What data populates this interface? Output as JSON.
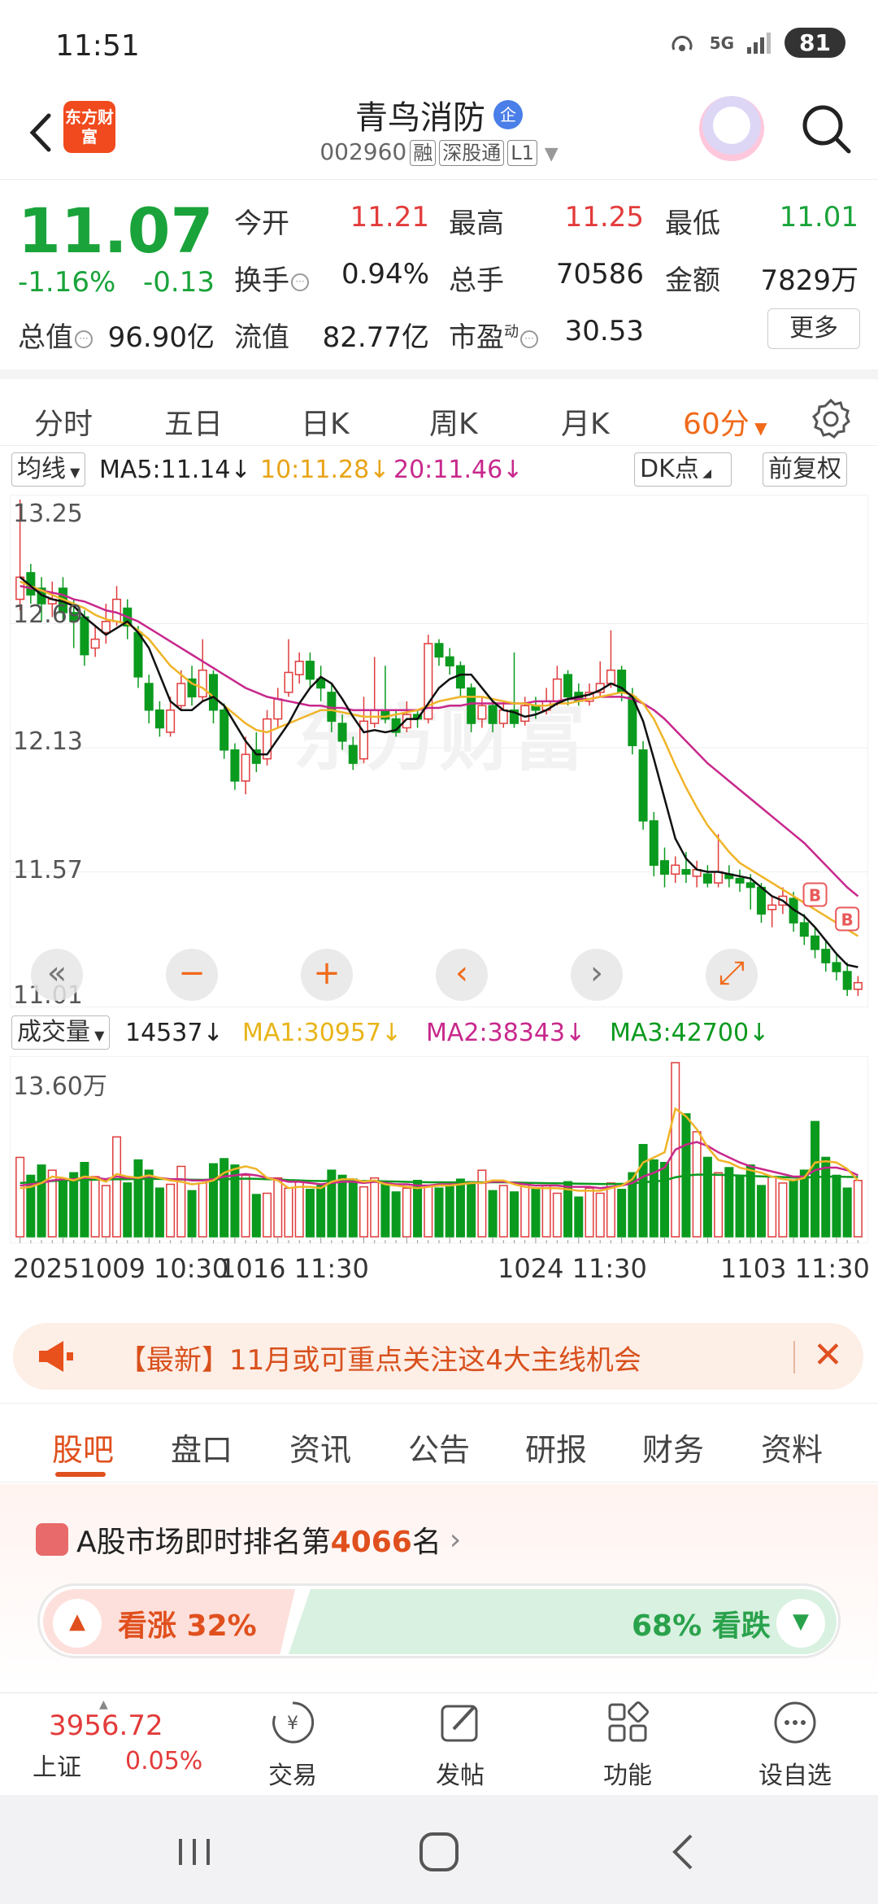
{
  "status": {
    "time": "11:51",
    "network": "5G",
    "battery": "81"
  },
  "header": {
    "app_logo_text": "东方财富",
    "stock_name": "青鸟消防",
    "badge": "企",
    "code": "002960",
    "tags": [
      "融",
      "深股通",
      "L1"
    ]
  },
  "quote": {
    "price": "11.07",
    "change_pct": "-1.16%",
    "change_amt": "-0.13",
    "open_label": "今开",
    "open": "11.21",
    "high_label": "最高",
    "high": "11.25",
    "low_label": "最低",
    "low": "11.01",
    "turnover_label": "换手",
    "turnover": "0.94%",
    "volume_label": "总手",
    "volume": "70586",
    "amount_label": "金额",
    "amount": "7829万",
    "mktcap_label": "总值",
    "mktcap": "96.90亿",
    "float_label": "流值",
    "float": "82.77亿",
    "pe_label": "市盈",
    "pe_sup": "动",
    "pe": "30.53",
    "more": "更多"
  },
  "period_tabs": [
    "分时",
    "五日",
    "日K",
    "周K",
    "月K",
    "60分"
  ],
  "active_period": "60分",
  "indicators": {
    "ma_select": "均线",
    "ma5": "MA5:11.14",
    "ma10": "10:11.28",
    "ma20": "20:11.46",
    "dk_select": "DK点",
    "adjust": "前复权",
    "vol_select": "成交量",
    "vol_now": "14537",
    "vma1": "MA1:30957",
    "vma2": "MA2:38343",
    "vma3": "MA3:42700"
  },
  "chart_labels": {
    "y_ticks": [
      "13.25",
      "12.69",
      "12.13",
      "11.57",
      "11.01"
    ],
    "vol_max": "13.60万",
    "x_ticks": [
      "20251009 10:30",
      "1016 11:30",
      "1024 11:30",
      "1103 11:30"
    ],
    "watermark": "东方财富"
  },
  "chart_colors": {
    "up": "#e03c3c",
    "down": "#0a9a1e",
    "ma5": "#111111",
    "ma10": "#f0b428",
    "ma20": "#c8288c",
    "vma3": "#0a9a1e"
  },
  "chart_data": {
    "type": "candlestick",
    "ylim": [
      11.01,
      13.25
    ],
    "candles": [
      [
        12.8,
        12.9,
        13.25,
        12.75
      ],
      [
        12.92,
        12.82,
        12.96,
        12.78
      ],
      [
        12.85,
        12.78,
        12.9,
        12.7
      ],
      [
        12.78,
        12.8,
        12.88,
        12.72
      ],
      [
        12.85,
        12.74,
        12.9,
        12.7
      ],
      [
        12.74,
        12.7,
        12.8,
        12.58
      ],
      [
        12.72,
        12.55,
        12.75,
        12.5
      ],
      [
        12.58,
        12.62,
        12.68,
        12.54
      ],
      [
        12.65,
        12.7,
        12.78,
        12.6
      ],
      [
        12.7,
        12.8,
        12.86,
        12.68
      ],
      [
        12.76,
        12.68,
        12.8,
        12.62
      ],
      [
        12.65,
        12.45,
        12.68,
        12.4
      ],
      [
        12.42,
        12.3,
        12.46,
        12.24
      ],
      [
        12.3,
        12.22,
        12.34,
        12.18
      ],
      [
        12.2,
        12.3,
        12.36,
        12.18
      ],
      [
        12.32,
        12.42,
        12.48,
        12.3
      ],
      [
        12.44,
        12.36,
        12.5,
        12.32
      ],
      [
        12.36,
        12.48,
        12.62,
        12.34
      ],
      [
        12.46,
        12.3,
        12.48,
        12.24
      ],
      [
        12.3,
        12.12,
        12.33,
        12.08
      ],
      [
        12.12,
        11.98,
        12.15,
        11.94
      ],
      [
        11.98,
        12.1,
        12.18,
        11.92
      ],
      [
        12.12,
        12.06,
        12.2,
        12.02
      ],
      [
        12.08,
        12.26,
        12.3,
        12.05
      ],
      [
        12.26,
        12.35,
        12.4,
        12.22
      ],
      [
        12.38,
        12.47,
        12.62,
        12.36
      ],
      [
        12.46,
        12.52,
        12.56,
        12.42
      ],
      [
        12.52,
        12.44,
        12.56,
        12.4
      ],
      [
        12.44,
        12.4,
        12.5,
        12.34
      ],
      [
        12.38,
        12.25,
        12.42,
        12.2
      ],
      [
        12.24,
        12.16,
        12.28,
        12.12
      ],
      [
        12.14,
        12.06,
        12.18,
        12.03
      ],
      [
        12.08,
        12.25,
        12.36,
        12.06
      ],
      [
        12.24,
        12.3,
        12.54,
        12.22
      ],
      [
        12.3,
        12.26,
        12.5,
        12.24
      ],
      [
        12.26,
        12.2,
        12.3,
        12.18
      ],
      [
        12.22,
        12.28,
        12.34,
        12.2
      ],
      [
        12.28,
        12.26,
        12.3,
        12.22
      ],
      [
        12.26,
        12.6,
        12.64,
        12.24
      ],
      [
        12.6,
        12.54,
        12.62,
        12.5
      ],
      [
        12.54,
        12.5,
        12.58,
        12.46
      ],
      [
        12.5,
        12.4,
        12.52,
        12.36
      ],
      [
        12.4,
        12.24,
        12.42,
        12.2
      ],
      [
        12.26,
        12.32,
        12.36,
        12.22
      ],
      [
        12.32,
        12.24,
        12.34,
        12.2
      ],
      [
        12.24,
        12.3,
        12.34,
        12.22
      ],
      [
        12.3,
        12.24,
        12.56,
        12.22
      ],
      [
        12.25,
        12.32,
        12.36,
        12.23
      ],
      [
        12.32,
        12.3,
        12.36,
        12.26
      ],
      [
        12.3,
        12.34,
        12.4,
        12.28
      ],
      [
        12.34,
        12.44,
        12.5,
        12.32
      ],
      [
        12.46,
        12.36,
        12.48,
        12.32
      ],
      [
        12.38,
        12.34,
        12.42,
        12.32
      ],
      [
        12.34,
        12.38,
        12.42,
        12.32
      ],
      [
        12.38,
        12.42,
        12.52,
        12.36
      ],
      [
        12.42,
        12.48,
        12.66,
        12.4
      ],
      [
        12.48,
        12.38,
        12.5,
        12.34
      ],
      [
        12.36,
        12.14,
        12.4,
        12.1
      ],
      [
        12.12,
        11.8,
        12.16,
        11.76
      ],
      [
        11.8,
        11.6,
        11.84,
        11.55
      ],
      [
        11.62,
        11.56,
        11.68,
        11.5
      ],
      [
        11.56,
        11.6,
        11.64,
        11.52
      ],
      [
        11.58,
        11.56,
        11.66,
        11.52
      ],
      [
        11.55,
        11.58,
        11.62,
        11.5
      ],
      [
        11.56,
        11.52,
        11.6,
        11.5
      ],
      [
        11.52,
        11.57,
        11.74,
        11.5
      ],
      [
        11.56,
        11.54,
        11.6,
        11.5
      ],
      [
        11.54,
        11.52,
        11.58,
        11.48
      ],
      [
        11.52,
        11.5,
        11.56,
        11.4
      ],
      [
        11.5,
        11.38,
        11.52,
        11.34
      ],
      [
        11.4,
        11.42,
        11.46,
        11.32
      ],
      [
        11.42,
        11.46,
        11.5,
        11.38
      ],
      [
        11.45,
        11.34,
        11.48,
        11.3
      ],
      [
        11.34,
        11.28,
        11.38,
        11.24
      ],
      [
        11.28,
        11.22,
        11.32,
        11.18
      ],
      [
        11.22,
        11.16,
        11.26,
        11.12
      ],
      [
        11.16,
        11.12,
        11.2,
        11.08
      ],
      [
        11.12,
        11.04,
        11.16,
        11.01
      ],
      [
        11.04,
        11.07,
        11.1,
        11.01
      ]
    ],
    "ma5": [
      12.9,
      12.86,
      12.82,
      12.8,
      12.79,
      12.77,
      12.72,
      12.68,
      12.64,
      12.67,
      12.7,
      12.65,
      12.58,
      12.46,
      12.34,
      12.3,
      12.3,
      12.34,
      12.36,
      12.32,
      12.24,
      12.16,
      12.1,
      12.1,
      12.17,
      12.24,
      12.33,
      12.4,
      12.45,
      12.42,
      12.35,
      12.27,
      12.2,
      12.21,
      12.2,
      12.21,
      12.26,
      12.26,
      12.33,
      12.4,
      12.44,
      12.46,
      12.46,
      12.4,
      12.34,
      12.3,
      12.29,
      12.27,
      12.28,
      12.3,
      12.33,
      12.35,
      12.36,
      12.37,
      12.39,
      12.42,
      12.4,
      12.36,
      12.25,
      12.08,
      11.9,
      11.72,
      11.63,
      11.58,
      11.57,
      11.57,
      11.56,
      11.55,
      11.54,
      11.5,
      11.46,
      11.44,
      11.4,
      11.37,
      11.32,
      11.26,
      11.2,
      11.15,
      11.14
    ],
    "ma10": [
      12.88,
      12.86,
      12.84,
      12.82,
      12.8,
      12.78,
      12.76,
      12.73,
      12.71,
      12.7,
      12.69,
      12.66,
      12.62,
      12.56,
      12.5,
      12.46,
      12.42,
      12.4,
      12.36,
      12.32,
      12.28,
      12.24,
      12.21,
      12.2,
      12.22,
      12.24,
      12.26,
      12.28,
      12.3,
      12.3,
      12.29,
      12.28,
      12.27,
      12.27,
      12.27,
      12.28,
      12.29,
      12.3,
      12.32,
      12.34,
      12.35,
      12.36,
      12.36,
      12.36,
      12.35,
      12.34,
      12.33,
      12.33,
      12.32,
      12.32,
      12.33,
      12.33,
      12.34,
      12.35,
      12.36,
      12.37,
      12.38,
      12.37,
      12.33,
      12.26,
      12.16,
      12.05,
      11.95,
      11.86,
      11.78,
      11.72,
      11.66,
      11.61,
      11.58,
      11.55,
      11.52,
      11.49,
      11.46,
      11.43,
      11.4,
      11.37,
      11.34,
      11.31,
      11.28
    ],
    "ma20": [
      12.86,
      12.85,
      12.84,
      12.83,
      12.82,
      12.8,
      12.79,
      12.77,
      12.75,
      12.74,
      12.72,
      12.7,
      12.67,
      12.64,
      12.61,
      12.58,
      12.55,
      12.52,
      12.49,
      12.46,
      12.43,
      12.4,
      12.38,
      12.36,
      12.35,
      12.34,
      12.33,
      12.32,
      12.32,
      12.31,
      12.31,
      12.3,
      12.3,
      12.3,
      12.3,
      12.3,
      12.3,
      12.3,
      12.31,
      12.31,
      12.32,
      12.32,
      12.33,
      12.33,
      12.33,
      12.33,
      12.33,
      12.33,
      12.34,
      12.34,
      12.34,
      12.35,
      12.35,
      12.35,
      12.36,
      12.36,
      12.36,
      12.35,
      12.33,
      12.3,
      12.26,
      12.21,
      12.16,
      12.11,
      12.06,
      12.02,
      11.98,
      11.94,
      11.9,
      11.86,
      11.82,
      11.78,
      11.74,
      11.7,
      11.65,
      11.6,
      11.55,
      11.5,
      11.46
    ],
    "volume": [
      62000,
      48000,
      56000,
      52000,
      44000,
      50000,
      58000,
      47000,
      40000,
      78000,
      42000,
      60000,
      52000,
      38000,
      41000,
      55000,
      36000,
      42000,
      57000,
      61000,
      56000,
      48000,
      33000,
      34000,
      46000,
      38000,
      44000,
      37000,
      40000,
      52000,
      48000,
      45000,
      39000,
      46000,
      41000,
      35000,
      38000,
      44000,
      40000,
      38000,
      40000,
      45000,
      43000,
      52000,
      36000,
      40000,
      35000,
      42000,
      37000,
      40000,
      34000,
      43000,
      31000,
      38000,
      34000,
      42000,
      37000,
      50000,
      72000,
      60000,
      58000,
      136000,
      96000,
      82000,
      62000,
      50000,
      54000,
      48000,
      56000,
      40000,
      47000,
      42000,
      44000,
      52000,
      90000,
      62000,
      48000,
      38000,
      44000
    ],
    "vma1": [
      38000,
      39000,
      42000,
      47000,
      46000,
      44000,
      47000,
      46000,
      43000,
      49000,
      47000,
      46000,
      48000,
      46000,
      44000,
      43000,
      41000,
      42000,
      44000,
      50000,
      53000,
      55000,
      53000,
      46000,
      44000,
      38000,
      39000,
      39000,
      38000,
      43000,
      45000,
      45000,
      43000,
      44000,
      41000,
      40000,
      39000,
      38000,
      39000,
      40000,
      40000,
      41000,
      42000,
      42000,
      44000,
      44000,
      41000,
      39000,
      38000,
      38000,
      38000,
      37000,
      36000,
      36000,
      36000,
      38000,
      40000,
      45000,
      58000,
      62000,
      66000,
      100000,
      94000,
      84000,
      70000,
      60000,
      58000,
      54000,
      52000,
      50000,
      47000,
      45000,
      44000,
      46000,
      58000,
      59000,
      58000,
      53000,
      44000
    ],
    "vma2": [
      40000,
      41000,
      42000,
      44000,
      45000,
      45000,
      46000,
      46000,
      45000,
      47000,
      46000,
      46000,
      47000,
      46000,
      45000,
      45000,
      44000,
      44000,
      45000,
      47000,
      48000,
      49000,
      48000,
      46000,
      45000,
      43000,
      43000,
      42000,
      41000,
      42000,
      43000,
      43000,
      42000,
      43000,
      42000,
      41000,
      41000,
      40000,
      40000,
      41000,
      41000,
      41000,
      42000,
      42000,
      43000,
      43000,
      42000,
      41000,
      40000,
      40000,
      40000,
      39000,
      39000,
      39000,
      38000,
      39000,
      40000,
      42000,
      47000,
      50000,
      54000,
      68000,
      72000,
      74000,
      71000,
      66000,
      62000,
      58000,
      55000,
      53000,
      51000,
      49000,
      47000,
      47000,
      52000,
      54000,
      54000,
      52000,
      48000
    ],
    "vma3": [
      42000,
      42500,
      43000,
      43500,
      44000,
      44200,
      44500,
      44600,
      44700,
      45000,
      45000,
      45200,
      45300,
      45200,
      45000,
      44800,
      44600,
      44500,
      44600,
      45000,
      45200,
      45400,
      45300,
      45000,
      44800,
      44300,
      44000,
      43700,
      43500,
      43600,
      43700,
      43700,
      43500,
      43500,
      43300,
      43100,
      42900,
      42700,
      42600,
      42600,
      42500,
      42500,
      42500,
      42500,
      42600,
      42600,
      42400,
      42200,
      42000,
      41900,
      41800,
      41600,
      41500,
      41400,
      41200,
      41200,
      41300,
      41700,
      42600,
      43200,
      44000,
      46500,
      47800,
      48500,
      48600,
      48400,
      48200,
      47800,
      47500,
      47200,
      46900,
      46600,
      46300,
      46200,
      46700,
      46900,
      47000,
      46800,
      46600
    ],
    "marker_label": "B"
  },
  "chart_controls": [
    "«",
    "−",
    "+",
    "‹",
    "›",
    "⤢"
  ],
  "news": {
    "text": "【最新】11月或可重点关注这4大主线机会"
  },
  "lower_tabs": [
    "股吧",
    "盘口",
    "资讯",
    "公告",
    "研报",
    "财务",
    "资料"
  ],
  "rank": {
    "prefix": "A股市场即时排名第",
    "num": "4066",
    "suffix": "名",
    "bull": "看涨 32%",
    "bear": "68% 看跌"
  },
  "toolbar": {
    "index_value": "3956.72",
    "index_name": "上证",
    "index_change": "0.05%",
    "items": [
      "交易",
      "发帖",
      "功能",
      "设自选"
    ]
  }
}
